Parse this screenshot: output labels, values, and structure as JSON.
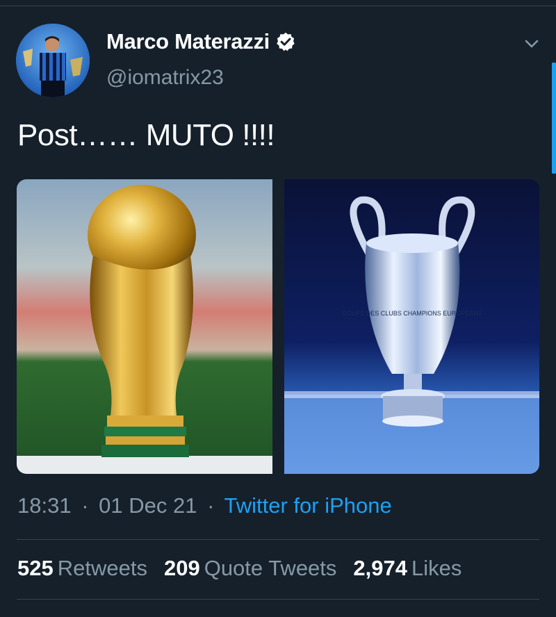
{
  "colors": {
    "background": "#15202b",
    "primary_text": "#ffffff",
    "secondary_text": "#8899a6",
    "accent": "#1da1f2",
    "divider": "#38444d"
  },
  "author": {
    "display_name": "Marco Materazzi",
    "handle": "@iomatrix23",
    "verified": true,
    "avatar_icon": "avatar-photo"
  },
  "tweet": {
    "text": "Post…… MUTO !!!!",
    "media": [
      {
        "name": "world-cup-trophy-photo",
        "cup_lettering": ""
      },
      {
        "name": "champions-league-trophy-photo",
        "cup_lettering": "COUPE DES CLUBS CHAMPIONS EUROPÉENS"
      }
    ],
    "time": "18:31",
    "date": "01 Dec 21",
    "separator": "·",
    "source": "Twitter for iPhone"
  },
  "stats": {
    "retweets": {
      "count": "525",
      "label": "Retweets"
    },
    "quote_tweets": {
      "count": "209",
      "label": "Quote Tweets"
    },
    "likes": {
      "count": "2,974",
      "label": "Likes"
    }
  }
}
